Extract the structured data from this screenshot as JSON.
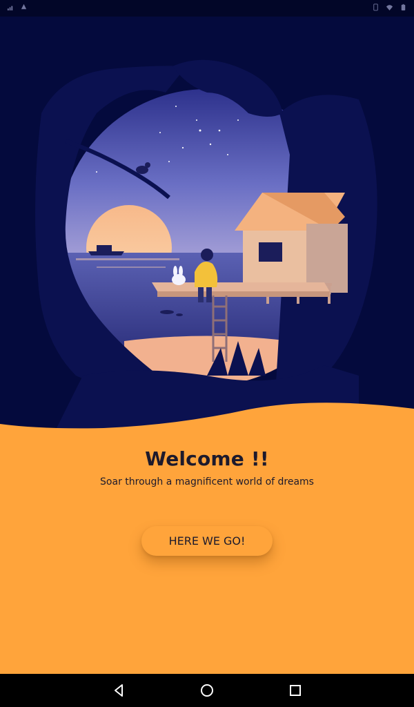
{
  "welcome": {
    "title": "Welcome !!",
    "subtitle": "Soar through a magnificent world of dreams",
    "cta_label": "HERE WE GO!"
  },
  "status_bar": {
    "icons": [
      "signal-icon",
      "notification-icon",
      "vibrate-icon",
      "wifi-icon",
      "battery-icon"
    ]
  },
  "navigation": {
    "icons": [
      "back-icon",
      "home-icon",
      "recents-icon"
    ]
  },
  "colors": {
    "background_dark": "#040a3d",
    "accent_orange": "#ffa43b",
    "text_dark": "#1d1a2c"
  }
}
